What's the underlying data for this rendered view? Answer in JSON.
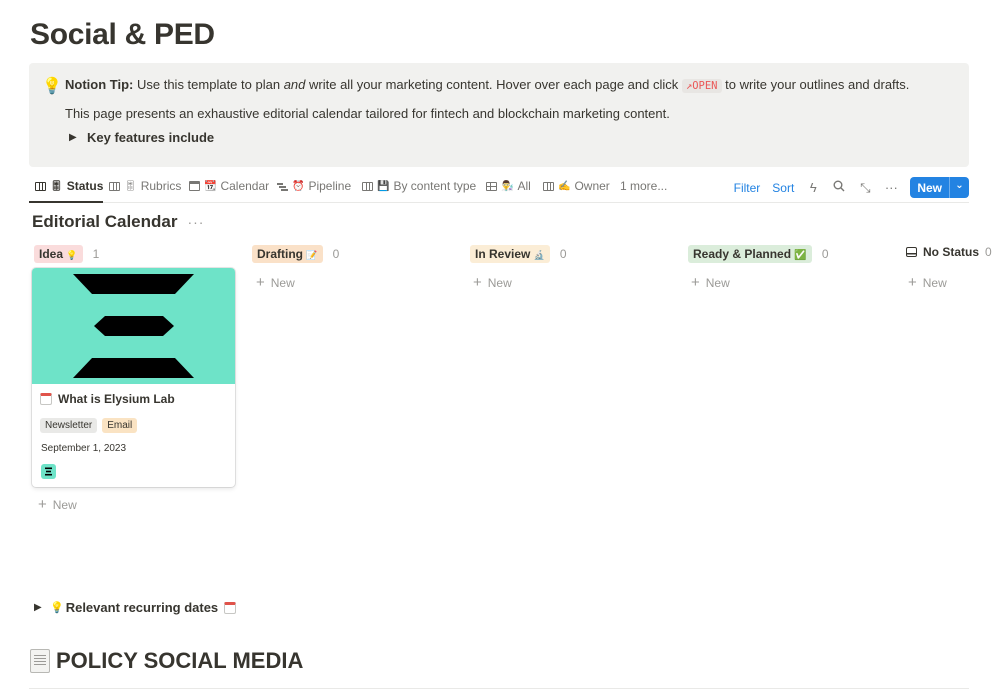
{
  "page": {
    "title": "Social & PED"
  },
  "callout": {
    "icon": "lightbulb-icon",
    "tip_label": "Notion Tip:",
    "tip_text_1": "Use this template to plan",
    "tip_text_em": "and",
    "tip_text_2": "write all your marketing content. Hover over each page and click",
    "code_text": "↗OPEN",
    "tip_text_3": "to write your outlines and drafts.",
    "description": "This page presents an exhaustive editorial calendar tailored for fintech and blockchain marketing content.",
    "toggle_label": "Key features include"
  },
  "tabs": [
    {
      "label": "Status",
      "emoji": "🎚"
    },
    {
      "label": "Rubrics",
      "emoji": "🎚"
    },
    {
      "label": "Calendar",
      "emoji": "📆"
    },
    {
      "label": "Pipeline",
      "emoji": "⏰"
    },
    {
      "label": "By content type",
      "emoji": "💾"
    },
    {
      "label": "All",
      "emoji": "👨‍🔬"
    },
    {
      "label": "Owner",
      "emoji": "✍️"
    },
    {
      "label": "1 more..."
    }
  ],
  "toolbar": {
    "filter": "Filter",
    "sort": "Sort",
    "new": "New"
  },
  "database": {
    "title": "Editorial Calendar",
    "more": "···"
  },
  "columns": [
    {
      "label": "Idea",
      "emoji": "💡",
      "count": "1",
      "color": "#fadcdc"
    },
    {
      "label": "Drafting",
      "emoji": "📝",
      "count": "0",
      "color": "#fae1c8"
    },
    {
      "label": "In Review",
      "emoji": "🔬",
      "count": "0",
      "color": "#fbedd6"
    },
    {
      "label": "Ready & Planned",
      "emoji": "✅",
      "count": "0",
      "color": "#dbeddb"
    },
    {
      "label": "No Status",
      "count": "0"
    }
  ],
  "add_new_label": "New",
  "card": {
    "title": "What is Elysium Lab",
    "tags": [
      {
        "label": "Newsletter",
        "color": "#e9e9e7"
      },
      {
        "label": "Email",
        "color": "#fae3c3"
      }
    ],
    "date": "September 1, 2023",
    "cover_color": "#6ee3c8"
  },
  "recurring": {
    "emoji": "💡",
    "label": "Relevant recurring dates"
  },
  "policy": {
    "title": "POLICY SOCIAL MEDIA"
  }
}
